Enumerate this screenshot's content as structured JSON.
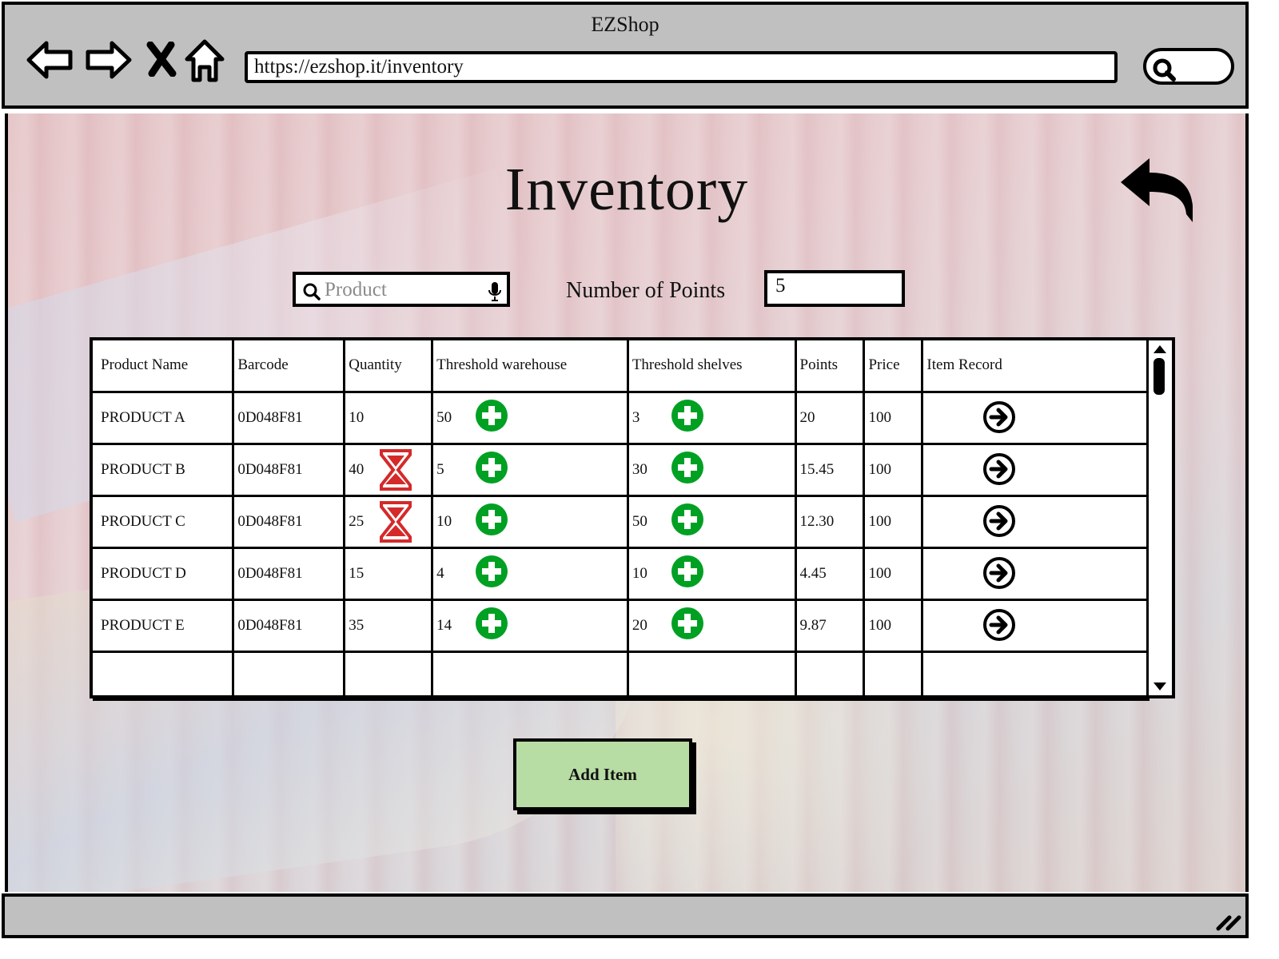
{
  "window": {
    "title": "EZShop"
  },
  "browser": {
    "url": "https://ezshop.it/inventory",
    "nav_icons": [
      "back-arrow-icon",
      "forward-arrow-icon",
      "close-x-icon",
      "home-icon"
    ]
  },
  "page": {
    "title": "Inventory",
    "search": {
      "placeholder": "Product",
      "value": ""
    },
    "points": {
      "label": "Number of Points",
      "value": "5"
    }
  },
  "table": {
    "headers": [
      "Product Name",
      "Barcode",
      "Quantity",
      "Threshold warehouse",
      "Threshold shelves",
      "Points",
      "Price",
      "Item Record"
    ],
    "rows": [
      {
        "name": "PRODUCT A",
        "barcode": "0D048F81",
        "quantity": "10",
        "pending": false,
        "th_warehouse": "50",
        "th_shelves": "3",
        "points": "20",
        "price": "100"
      },
      {
        "name": "PRODUCT B",
        "barcode": "0D048F81",
        "quantity": "40",
        "pending": true,
        "th_warehouse": "5",
        "th_shelves": "30",
        "points": "15.45",
        "price": "100"
      },
      {
        "name": "PRODUCT C",
        "barcode": "0D048F81",
        "quantity": "25",
        "pending": true,
        "th_warehouse": "10",
        "th_shelves": "50",
        "points": "12.30",
        "price": "100"
      },
      {
        "name": "PRODUCT D",
        "barcode": "0D048F81",
        "quantity": "15",
        "pending": false,
        "th_warehouse": "4",
        "th_shelves": "10",
        "points": "4.45",
        "price": "100"
      },
      {
        "name": "PRODUCT E",
        "barcode": "0D048F81",
        "quantity": "35",
        "pending": false,
        "th_warehouse": "14",
        "th_shelves": "20",
        "points": "9.87",
        "price": "100"
      }
    ]
  },
  "actions": {
    "add_item_label": "Add Item"
  },
  "colors": {
    "accent_green": "#00a023",
    "button_green": "#b7dca4",
    "hourglass_red": "#d42a2a",
    "chrome_gray": "#c0c0c0"
  }
}
